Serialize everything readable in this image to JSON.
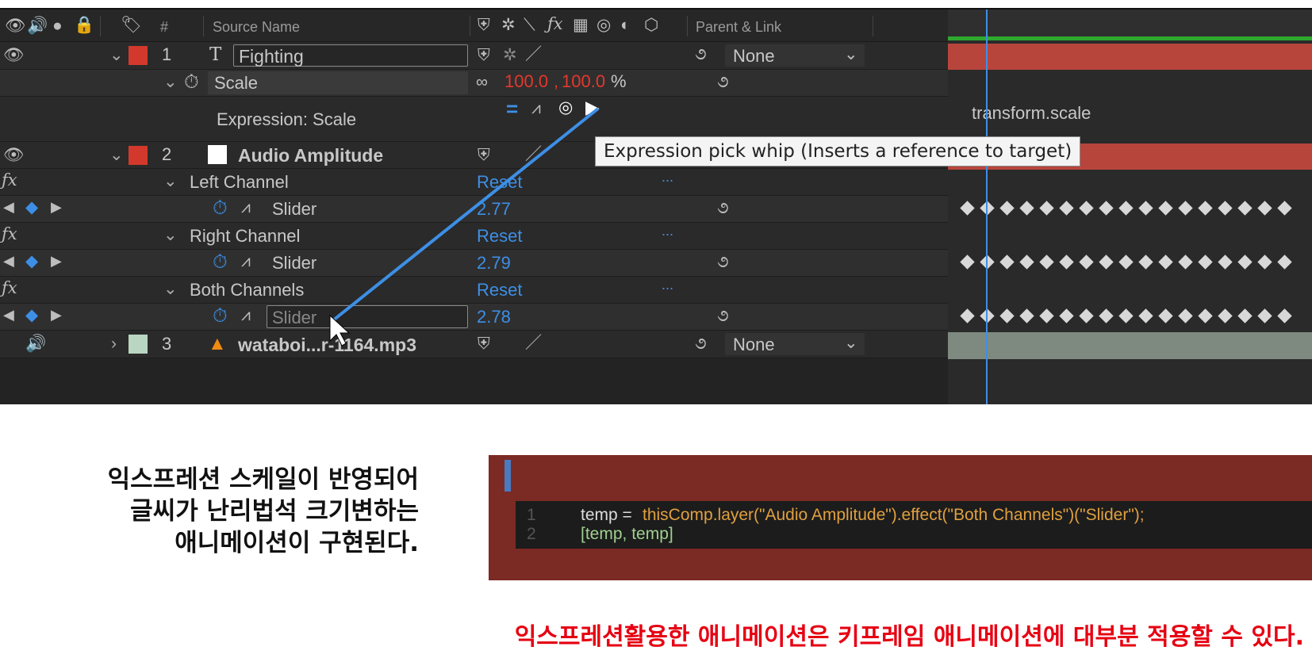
{
  "header": {
    "hash": "#",
    "source_name": "Source Name",
    "parent_link": "Parent & Link"
  },
  "layers": [
    {
      "number": "1",
      "name": "Fighting",
      "type_icon": "T",
      "parent": "None",
      "color": "#d2392c"
    },
    {
      "number": "2",
      "name": "Audio Amplitude",
      "parent": "",
      "color": "#d2392c"
    },
    {
      "number": "3",
      "name": "wataboi...r-1164.mp3",
      "parent": "None",
      "color": "#b9d6c2"
    }
  ],
  "scale": {
    "label": "Scale",
    "value_x": "100.0",
    "comma": ",",
    "value_y": "100.0",
    "unit": "%"
  },
  "expression": {
    "label": "Expression: Scale",
    "equals": "=",
    "timeline_text": "transform.scale"
  },
  "tooltip": "Expression pick whip (Inserts a reference to target)",
  "effects": [
    {
      "name": "Left Channel",
      "reset": "Reset",
      "dots": "...",
      "slider_label": "Slider",
      "slider_value": "2.77"
    },
    {
      "name": "Right Channel",
      "reset": "Reset",
      "dots": "...",
      "slider_label": "Slider",
      "slider_value": "2.79"
    },
    {
      "name": "Both Channels",
      "reset": "Reset",
      "dots": "...",
      "slider_label": "Slider",
      "slider_value": "2.78"
    }
  ],
  "fx_label": "fx",
  "code": {
    "line1_num": "1",
    "line2_num": "2",
    "line1_a": "temp = ",
    "line1_b": "thisComp.layer(\"Audio Amplitude\").effect(\"Both Channels\")(\"Slider\");",
    "line2": "[temp, temp]"
  },
  "caption": [
    "익스프레션 스케일이 반영되어",
    "글씨가 난리법석 크기변하는",
    "애니메이션이 구현된다."
  ],
  "bottom_note": "익스프레션활용한 애니메이션은 키프레임 애니메이션에 대부분 적용할 수 있다.",
  "colors": {
    "accent_blue": "#3d8fe6",
    "value_red": "#e5372c",
    "note_red": "#e60012",
    "timeline_bar": "#b8453c"
  }
}
